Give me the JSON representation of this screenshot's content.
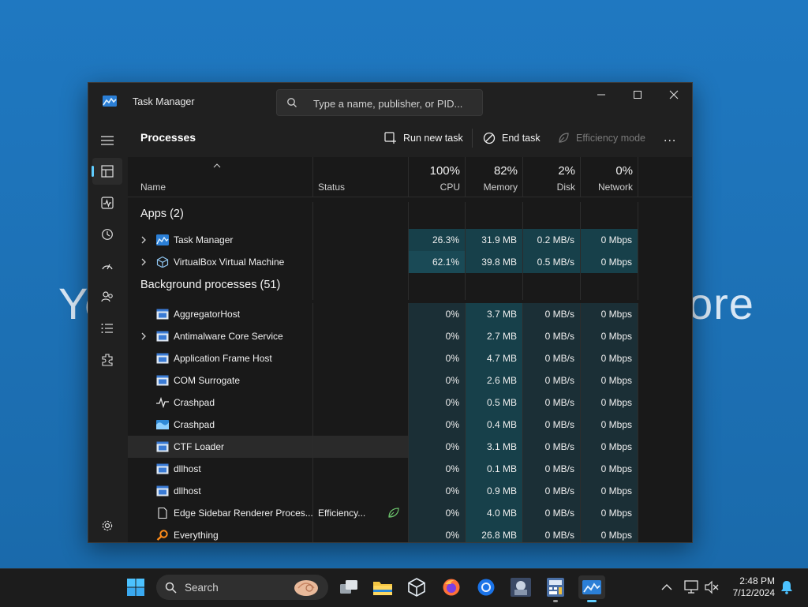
{
  "desktop": {
    "bg_text_left": "Yo",
    "bg_text_right": "ore"
  },
  "window": {
    "title": "Task Manager",
    "search_placeholder": "Type a name, publisher, or PID...",
    "controls": [
      "minimize",
      "maximize",
      "close"
    ]
  },
  "sidebar": {
    "items": [
      {
        "name": "menu-icon"
      },
      {
        "name": "processes-icon",
        "active": true
      },
      {
        "name": "performance-icon"
      },
      {
        "name": "app-history-icon"
      },
      {
        "name": "startup-apps-icon"
      },
      {
        "name": "users-icon"
      },
      {
        "name": "details-icon"
      },
      {
        "name": "services-icon"
      }
    ],
    "settings_icon": "gear-icon"
  },
  "toolbar": {
    "page_title": "Processes",
    "run_new_task": "Run new task",
    "end_task": "End task",
    "efficiency_mode": "Efficiency mode",
    "more": "..."
  },
  "columns": {
    "name": "Name",
    "status": "Status",
    "cpu": {
      "pct": "100%",
      "label": "CPU"
    },
    "memory": {
      "pct": "82%",
      "label": "Memory"
    },
    "disk": {
      "pct": "2%",
      "label": "Disk"
    },
    "network": {
      "pct": "0%",
      "label": "Network"
    }
  },
  "groups": {
    "apps": "Apps (2)",
    "background": "Background processes (51)"
  },
  "apps": [
    {
      "name": "Task Manager",
      "cpu": "26.3%",
      "memory": "31.9 MB",
      "disk": "0.2 MB/s",
      "network": "0 Mbps",
      "expand": true,
      "icon": "taskmanager-icon"
    },
    {
      "name": "VirtualBox Virtual Machine",
      "cpu": "62.1%",
      "memory": "39.8 MB",
      "disk": "0.5 MB/s",
      "network": "0 Mbps",
      "expand": true,
      "icon": "virtualbox-icon"
    }
  ],
  "background": [
    {
      "name": "AggregatorHost",
      "status": "",
      "cpu": "0%",
      "memory": "3.7 MB",
      "disk": "0 MB/s",
      "network": "0 Mbps",
      "expand": false,
      "icon": "window-app-icon"
    },
    {
      "name": "Antimalware Core Service",
      "status": "",
      "cpu": "0%",
      "memory": "2.7 MB",
      "disk": "0 MB/s",
      "network": "0 Mbps",
      "expand": true,
      "icon": "window-app-icon"
    },
    {
      "name": "Application Frame Host",
      "status": "",
      "cpu": "0%",
      "memory": "4.7 MB",
      "disk": "0 MB/s",
      "network": "0 Mbps",
      "expand": false,
      "icon": "window-app-icon"
    },
    {
      "name": "COM Surrogate",
      "status": "",
      "cpu": "0%",
      "memory": "2.6 MB",
      "disk": "0 MB/s",
      "network": "0 Mbps",
      "expand": false,
      "icon": "window-app-icon"
    },
    {
      "name": "Crashpad",
      "status": "",
      "cpu": "0%",
      "memory": "0.5 MB",
      "disk": "0 MB/s",
      "network": "0 Mbps",
      "expand": false,
      "icon": "pulse-icon"
    },
    {
      "name": "Crashpad",
      "status": "",
      "cpu": "0%",
      "memory": "0.4 MB",
      "disk": "0 MB/s",
      "network": "0 Mbps",
      "expand": false,
      "icon": "wave-icon"
    },
    {
      "name": "CTF Loader",
      "status": "",
      "cpu": "0%",
      "memory": "3.1 MB",
      "disk": "0 MB/s",
      "network": "0 Mbps",
      "expand": false,
      "icon": "window-app-icon",
      "highlight": true
    },
    {
      "name": "dllhost",
      "status": "",
      "cpu": "0%",
      "memory": "0.1 MB",
      "disk": "0 MB/s",
      "network": "0 Mbps",
      "expand": false,
      "icon": "window-app-icon"
    },
    {
      "name": "dllhost",
      "status": "",
      "cpu": "0%",
      "memory": "0.9 MB",
      "disk": "0 MB/s",
      "network": "0 Mbps",
      "expand": false,
      "icon": "window-app-icon"
    },
    {
      "name": "Edge Sidebar Renderer Proces...",
      "status": "Efficiency...",
      "cpu": "0%",
      "memory": "4.0 MB",
      "disk": "0 MB/s",
      "network": "0 Mbps",
      "expand": false,
      "icon": "document-icon",
      "efficiency_leaf": true
    },
    {
      "name": "Everything",
      "status": "",
      "cpu": "0%",
      "memory": "26.8 MB",
      "disk": "0 MB/s",
      "network": "0 Mbps",
      "expand": false,
      "icon": "magnifier-orange-icon"
    }
  ],
  "taskbar": {
    "search_label": "Search",
    "time": "2:48 PM",
    "date": "7/12/2024"
  },
  "colors": {
    "accent": "#60cdff",
    "heat_low": "#1b2f36",
    "heat_high": "#17404a",
    "desktop": "#1f78c1"
  }
}
